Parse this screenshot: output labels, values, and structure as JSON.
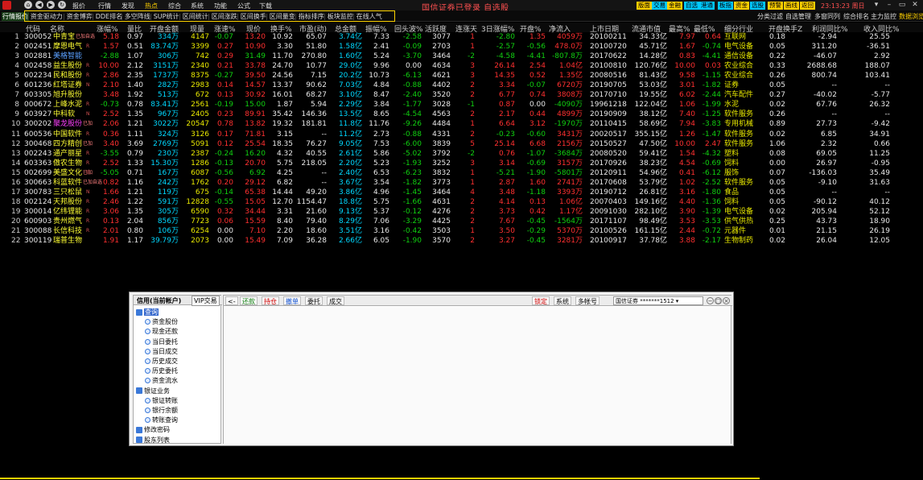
{
  "menubar": {
    "items": [
      "报价",
      "行情",
      "发现",
      "热点",
      "综合",
      "系统",
      "功能",
      "公式",
      "下载"
    ],
    "active_item": "热点",
    "title": "国信证券已登录  自选股",
    "buttons": [
      {
        "label": "版面",
        "color": "#ffd000"
      },
      {
        "label": "交易",
        "color": "#00c8ff"
      },
      {
        "label": "金融",
        "color": "#ffd000"
      },
      {
        "label": "自选",
        "color": "#00c8ff"
      },
      {
        "label": "港通",
        "color": "#00c8ff"
      },
      {
        "label": "板指",
        "color": "#00c8ff"
      },
      {
        "label": "资金",
        "color": "#ffd000"
      },
      {
        "label": "选股",
        "color": "#00c8ff"
      },
      {
        "label": "预警",
        "color": "#ffd000"
      },
      {
        "label": "画线",
        "color": "#ffd000"
      },
      {
        "label": "返回",
        "color": "#ffd000"
      }
    ],
    "time": "23:13:23 周日"
  },
  "toolbar": {
    "first": "行情报价",
    "items": [
      "资金驱动力",
      "资金博弈",
      "DDE排名",
      "多空阵线",
      "SUP统计",
      "区间统计",
      "区间涨跌",
      "区间换手",
      "区间量变",
      "指标排序",
      "板块监控",
      "在线人气"
    ],
    "right_items": [
      "分类过滤",
      "自选管理",
      "多窗同列",
      "综合排名",
      "主力监控",
      "数据浏览"
    ]
  },
  "table": {
    "headers": [
      "代码",
      "名称",
      "涨幅%",
      "量比",
      "开盘金额",
      "现量",
      "涨速%",
      "现价",
      "换手%",
      "市盈(动)",
      "总金额",
      "振幅%",
      "回头波%",
      "活跃度",
      "连涨天",
      "3日涨幅%",
      "开盘%",
      "净流入",
      "上市日期",
      "流通市值",
      "最高%",
      "最低%",
      "细分行业",
      "开盘换手Z",
      "利润同比%",
      "收入同比%"
    ],
    "rows": [
      {
        "i": "1",
        "code": "300052",
        "name": "中青宝",
        "nc": "y",
        "tag": "已加自选",
        "flag": "",
        "chg": "5.18",
        "lb": "0.97",
        "kje": "334万",
        "xl": "4147",
        "zs": "-0.07",
        "xj": "13.20",
        "hs": "10.92",
        "syl": "65.07",
        "zje": "3.74亿",
        "zf": "7.33",
        "htb": "-2.58",
        "hyd": "3077",
        "lzt": "1",
        "r3": "-2.80",
        "kp": "1.35",
        "jlr": "4059万",
        "ssrq": "20100211",
        "ltsz": "34.33亿",
        "zg": "7.97",
        "zd": "0.64",
        "hy": "互联网",
        "kphs": "0.18",
        "lr": "-2.94",
        "sr": "25.55"
      },
      {
        "i": "2",
        "code": "002451",
        "name": "摩恩电气",
        "nc": "y",
        "tag": "",
        "flag": "R",
        "chg": "1.57",
        "lb": "0.51",
        "kje": "83.74万",
        "xl": "3399",
        "zs": "0.27",
        "xj": "10.90",
        "hs": "3.30",
        "syl": "51.80",
        "zje": "1.58亿",
        "zf": "2.41",
        "htb": "-0.09",
        "hyd": "2703",
        "lzt": "1",
        "r3": "-2.57",
        "kp": "-0.56",
        "jlr": "478.0万",
        "ssrq": "20100720",
        "ltsz": "45.71亿",
        "zg": "1.67",
        "zd": "-0.74",
        "hy": "电气设备",
        "kphs": "0.05",
        "lr": "311.20",
        "sr": "-36.51"
      },
      {
        "i": "3",
        "code": "002881",
        "name": "美格智能",
        "nc": "b",
        "tag": "",
        "flag": "",
        "chg": "-2.88",
        "lb": "1.07",
        "kje": "306万",
        "xl": "742",
        "zs": "0.29",
        "xj": "31.49",
        "hs": "11.70",
        "syl": "270.80",
        "zje": "1.60亿",
        "zf": "5.24",
        "htb": "-3.70",
        "hyd": "3464",
        "lzt": "-2",
        "r3": "-4.58",
        "kp": "-4.41",
        "jlr": "-807.8万",
        "ssrq": "20170622",
        "ltsz": "14.28亿",
        "zg": "0.83",
        "zd": "-4.41",
        "hy": "通信设备",
        "kphs": "0.22",
        "lr": "-46.07",
        "sr": "2.92"
      },
      {
        "i": "4",
        "code": "002458",
        "name": "益生股份",
        "nc": "y",
        "tag": "",
        "flag": "R",
        "chg": "10.00",
        "lb": "2.12",
        "kje": "3151万",
        "xl": "2340",
        "zs": "0.21",
        "xj": "33.78",
        "hs": "24.70",
        "syl": "10.77",
        "zje": "29.0亿",
        "zf": "9.96",
        "htb": "0.00",
        "hyd": "4634",
        "lzt": "3",
        "r3": "26.14",
        "kp": "2.54",
        "jlr": "1.04亿",
        "ssrq": "20100810",
        "ltsz": "120.76亿",
        "zg": "10.00",
        "zd": "0.03",
        "hy": "农业综合",
        "kphs": "0.33",
        "lr": "2688.68",
        "sr": "188.07"
      },
      {
        "i": "5",
        "code": "002234",
        "name": "民和股份",
        "nc": "y",
        "tag": "",
        "flag": "R",
        "chg": "2.86",
        "lb": "2.35",
        "kje": "1737万",
        "xl": "8375",
        "zs": "-0.27",
        "xj": "39.50",
        "hs": "24.56",
        "syl": "7.15",
        "zje": "20.2亿",
        "zf": "10.73",
        "htb": "-6.13",
        "hyd": "4621",
        "lzt": "3",
        "r3": "14.35",
        "kp": "0.52",
        "jlr": "1.35亿",
        "ssrq": "20080516",
        "ltsz": "81.43亿",
        "zg": "9.58",
        "zd": "-1.15",
        "hy": "农业综合",
        "kphs": "0.26",
        "lr": "800.74",
        "sr": "103.41"
      },
      {
        "i": "6",
        "code": "601236",
        "name": "红塔证券",
        "nc": "y",
        "tag": "",
        "flag": "N",
        "chg": "2.10",
        "lb": "1.40",
        "kje": "282万",
        "xl": "2983",
        "zs": "0.14",
        "xj": "14.57",
        "hs": "13.37",
        "syl": "90.62",
        "zje": "7.03亿",
        "zf": "4.84",
        "htb": "-0.88",
        "hyd": "4402",
        "lzt": "2",
        "r3": "3.34",
        "kp": "-0.07",
        "jlr": "6720万",
        "ssrq": "20190705",
        "ltsz": "53.03亿",
        "zg": "3.01",
        "zd": "-1.82",
        "hy": "证券",
        "kphs": "0.05",
        "lr": "--",
        "sr": "--"
      },
      {
        "i": "7",
        "code": "603305",
        "name": "旭升股份",
        "nc": "y",
        "tag": "",
        "flag": "",
        "chg": "3.48",
        "lb": "1.92",
        "kje": "513万",
        "xl": "672",
        "zs": "0.13",
        "xj": "30.92",
        "hs": "16.01",
        "syl": "68.27",
        "zje": "3.10亿",
        "zf": "8.47",
        "htb": "-2.40",
        "hyd": "3520",
        "lzt": "2",
        "r3": "6.77",
        "kp": "0.74",
        "jlr": "3808万",
        "ssrq": "20170710",
        "ltsz": "19.55亿",
        "zg": "6.02",
        "zd": "-2.44",
        "hy": "汽车配件",
        "kphs": "0.27",
        "lr": "-40.02",
        "sr": "-5.77"
      },
      {
        "i": "8",
        "code": "000672",
        "name": "上峰水泥",
        "nc": "y",
        "tag": "",
        "flag": "R",
        "chg": "-0.73",
        "lb": "0.78",
        "kje": "83.41万",
        "xl": "2561",
        "zs": "-0.19",
        "xj": "15.00",
        "hs": "1.87",
        "syl": "5.94",
        "zje": "2.29亿",
        "zf": "3.84",
        "htb": "-1.77",
        "hyd": "3028",
        "lzt": "-1",
        "r3": "0.87",
        "kp": "0.00",
        "jlr": "-4090万",
        "ssrq": "19961218",
        "ltsz": "122.04亿",
        "zg": "1.06",
        "zd": "-1.99",
        "hy": "水泥",
        "kphs": "0.02",
        "lr": "67.76",
        "sr": "26.32"
      },
      {
        "i": "9",
        "code": "603927",
        "name": "中科软",
        "nc": "y",
        "tag": "",
        "flag": "N",
        "chg": "2.52",
        "lb": "1.35",
        "kje": "967万",
        "xl": "2405",
        "zs": "0.23",
        "xj": "89.91",
        "hs": "35.42",
        "syl": "146.36",
        "zje": "13.5亿",
        "zf": "8.65",
        "htb": "-4.54",
        "hyd": "4563",
        "lzt": "2",
        "r3": "2.17",
        "kp": "0.44",
        "jlr": "4899万",
        "ssrq": "20190909",
        "ltsz": "38.12亿",
        "zg": "7.40",
        "zd": "-1.25",
        "hy": "软件服务",
        "kphs": "0.26",
        "lr": "--",
        "sr": "--"
      },
      {
        "i": "10",
        "code": "300202",
        "name": "聚龙股份",
        "nc": "m",
        "tag": "已加",
        "flag": "",
        "chg": "2.06",
        "lb": "1.21",
        "kje": "3022万",
        "xl": "20547",
        "zs": "0.78",
        "xj": "13.82",
        "hs": "19.32",
        "syl": "181.81",
        "zje": "11.8亿",
        "zf": "11.76",
        "htb": "-9.26",
        "hyd": "4484",
        "lzt": "1",
        "r3": "6.64",
        "kp": "3.12",
        "jlr": "-1970万",
        "ssrq": "20110415",
        "ltsz": "58.69亿",
        "zg": "7.94",
        "zd": "-3.83",
        "hy": "专用机械",
        "kphs": "0.89",
        "lr": "27.73",
        "sr": "-9.42"
      },
      {
        "i": "11",
        "code": "600536",
        "name": "中国软件",
        "nc": "y",
        "tag": "",
        "flag": "R",
        "chg": "0.36",
        "lb": "1.11",
        "kje": "324万",
        "xl": "3126",
        "zs": "0.17",
        "xj": "71.81",
        "hs": "3.15",
        "syl": "--",
        "zje": "11.2亿",
        "zf": "2.73",
        "htb": "-0.88",
        "hyd": "4331",
        "lzt": "2",
        "r3": "-0.23",
        "kp": "-0.60",
        "jlr": "3431万",
        "ssrq": "20020517",
        "ltsz": "355.15亿",
        "zg": "1.26",
        "zd": "-1.47",
        "hy": "软件服务",
        "kphs": "0.02",
        "lr": "6.85",
        "sr": "34.91"
      },
      {
        "i": "12",
        "code": "300468",
        "name": "四方精创",
        "nc": "y",
        "tag": "已加",
        "flag": "",
        "chg": "3.40",
        "lb": "3.69",
        "kje": "2769万",
        "xl": "5091",
        "zs": "0.12",
        "xj": "25.54",
        "hs": "18.35",
        "syl": "76.27",
        "zje": "9.05亿",
        "zf": "7.53",
        "htb": "-6.00",
        "hyd": "3839",
        "lzt": "5",
        "r3": "25.14",
        "kp": "6.68",
        "jlr": "2156万",
        "ssrq": "20150527",
        "ltsz": "47.50亿",
        "zg": "10.00",
        "zd": "2.47",
        "hy": "软件服务",
        "kphs": "1.06",
        "lr": "2.32",
        "sr": "0.66"
      },
      {
        "i": "13",
        "code": "002243",
        "name": "通产丽星",
        "nc": "y",
        "tag": "",
        "flag": "R",
        "chg": "-3.55",
        "lb": "0.79",
        "kje": "230万",
        "xl": "2387",
        "zs": "-0.24",
        "xj": "16.20",
        "hs": "4.32",
        "syl": "40.55",
        "zje": "2.61亿",
        "zf": "5.86",
        "htb": "-5.02",
        "hyd": "3792",
        "lzt": "-2",
        "r3": "0.76",
        "kp": "-1.07",
        "jlr": "-3684万",
        "ssrq": "20080520",
        "ltsz": "59.41亿",
        "zg": "1.54",
        "zd": "-4.32",
        "hy": "塑料",
        "kphs": "0.08",
        "lr": "69.05",
        "sr": "11.25"
      },
      {
        "i": "14",
        "code": "603363",
        "name": "傲农生物",
        "nc": "y",
        "tag": "",
        "flag": "R",
        "chg": "2.52",
        "lb": "1.33",
        "kje": "15.30万",
        "xl": "1286",
        "zs": "-0.13",
        "xj": "20.70",
        "hs": "5.75",
        "syl": "218.05",
        "zje": "2.20亿",
        "zf": "5.23",
        "htb": "-1.93",
        "hyd": "3252",
        "lzt": "3",
        "r3": "3.14",
        "kp": "-0.69",
        "jlr": "3157万",
        "ssrq": "20170926",
        "ltsz": "38.23亿",
        "zg": "4.54",
        "zd": "-0.69",
        "hy": "饲料",
        "kphs": "0.00",
        "lr": "26.97",
        "sr": "-0.95"
      },
      {
        "i": "15",
        "code": "002699",
        "name": "美盛文化",
        "nc": "y",
        "tag": "已加",
        "flag": "R",
        "chg": "-5.05",
        "lb": "0.71",
        "kje": "167万",
        "xl": "6087",
        "zs": "-0.56",
        "xj": "6.92",
        "hs": "4.25",
        "syl": "--",
        "zje": "2.40亿",
        "zf": "6.53",
        "htb": "-6.23",
        "hyd": "3832",
        "lzt": "1",
        "r3": "-5.21",
        "kp": "-1.90",
        "jlr": "-5801万",
        "ssrq": "20120911",
        "ltsz": "54.96亿",
        "zg": "0.41",
        "zd": "-6.12",
        "hy": "服饰",
        "kphs": "0.07",
        "lr": "-136.03",
        "sr": "35.49"
      },
      {
        "i": "16",
        "code": "300663",
        "name": "科蓝软件",
        "nc": "y",
        "tag": "已加自选",
        "flag": "",
        "chg": "0.82",
        "lb": "1.16",
        "kje": "242万",
        "xl": "1762",
        "zs": "0.20",
        "xj": "29.12",
        "hs": "6.82",
        "syl": "--",
        "zje": "3.67亿",
        "zf": "3.54",
        "htb": "-1.82",
        "hyd": "3773",
        "lzt": "1",
        "r3": "2.87",
        "kp": "1.60",
        "jlr": "2741万",
        "ssrq": "20170608",
        "ltsz": "53.79亿",
        "zg": "1.02",
        "zd": "-2.52",
        "hy": "软件服务",
        "kphs": "0.05",
        "lr": "-9.10",
        "sr": "31.63"
      },
      {
        "i": "17",
        "code": "300783",
        "name": "三只松鼠",
        "nc": "y",
        "tag": "",
        "flag": "N",
        "chg": "1.66",
        "lb": "1.21",
        "kje": "119万",
        "xl": "675",
        "zs": "-0.14",
        "xj": "65.38",
        "hs": "14.44",
        "syl": "49.20",
        "zje": "3.86亿",
        "zf": "4.96",
        "htb": "-1.45",
        "hyd": "3464",
        "lzt": "4",
        "r3": "3.48",
        "kp": "-1.18",
        "jlr": "3393万",
        "ssrq": "20190712",
        "ltsz": "26.81亿",
        "zg": "3.16",
        "zd": "-1.80",
        "hy": "食品",
        "kphs": "0.05",
        "lr": "--",
        "sr": "--"
      },
      {
        "i": "18",
        "code": "002124",
        "name": "天邦股份",
        "nc": "y",
        "tag": "",
        "flag": "R",
        "chg": "2.46",
        "lb": "1.22",
        "kje": "591万",
        "xl": "12828",
        "zs": "-0.55",
        "xj": "15.05",
        "hs": "12.70",
        "syl": "1154.47",
        "zje": "18.8亿",
        "zf": "5.75",
        "htb": "-1.66",
        "hyd": "4631",
        "lzt": "2",
        "r3": "4.14",
        "kp": "0.13",
        "jlr": "1.06亿",
        "ssrq": "20070403",
        "ltsz": "149.16亿",
        "zg": "4.40",
        "zd": "-1.36",
        "hy": "饲料",
        "kphs": "0.05",
        "lr": "-90.12",
        "sr": "40.12"
      },
      {
        "i": "19",
        "code": "300014",
        "name": "亿纬锂能",
        "nc": "y",
        "tag": "",
        "flag": "R",
        "chg": "3.06",
        "lb": "1.35",
        "kje": "305万",
        "xl": "6590",
        "zs": "0.32",
        "xj": "34.44",
        "hs": "3.31",
        "syl": "21.60",
        "zje": "9.13亿",
        "zf": "5.37",
        "htb": "-0.12",
        "hyd": "4276",
        "lzt": "2",
        "r3": "3.73",
        "kp": "0.42",
        "jlr": "1.17亿",
        "ssrq": "20091030",
        "ltsz": "282.10亿",
        "zg": "3.90",
        "zd": "-1.39",
        "hy": "电气设备",
        "kphs": "0.02",
        "lr": "205.94",
        "sr": "52.12"
      },
      {
        "i": "20",
        "code": "600903",
        "name": "贵州燃气",
        "nc": "y",
        "tag": "",
        "flag": "R",
        "chg": "0.13",
        "lb": "2.04",
        "kje": "856万",
        "xl": "7723",
        "zs": "0.06",
        "xj": "15.59",
        "hs": "8.40",
        "syl": "79.40",
        "zje": "8.29亿",
        "zf": "7.06",
        "htb": "-3.29",
        "hyd": "4425",
        "lzt": "2",
        "r3": "7.67",
        "kp": "-0.45",
        "jlr": "-1564万",
        "ssrq": "20171107",
        "ltsz": "98.49亿",
        "zg": "3.53",
        "zd": "-3.53",
        "hy": "供气供热",
        "kphs": "0.25",
        "lr": "43.73",
        "sr": "18.90"
      },
      {
        "i": "21",
        "code": "300088",
        "name": "长信科技",
        "nc": "y",
        "tag": "",
        "flag": "R",
        "chg": "2.01",
        "lb": "0.80",
        "kje": "106万",
        "xl": "6254",
        "zs": "0.00",
        "xj": "7.10",
        "hs": "2.20",
        "syl": "18.60",
        "zje": "3.51亿",
        "zf": "3.16",
        "htb": "-0.42",
        "hyd": "3503",
        "lzt": "1",
        "r3": "3.50",
        "kp": "-0.29",
        "jlr": "5370万",
        "ssrq": "20100526",
        "ltsz": "161.15亿",
        "zg": "2.44",
        "zd": "-0.72",
        "hy": "元器件",
        "kphs": "0.01",
        "lr": "21.15",
        "sr": "26.19"
      },
      {
        "i": "22",
        "code": "300119",
        "name": "瑞普生物",
        "nc": "y",
        "tag": "",
        "flag": "",
        "chg": "1.91",
        "lb": "1.17",
        "kje": "39.79万",
        "xl": "2073",
        "zs": "0.00",
        "xj": "15.49",
        "hs": "7.09",
        "syl": "36.28",
        "zje": "2.66亿",
        "zf": "6.05",
        "htb": "-1.90",
        "hyd": "3570",
        "lzt": "2",
        "r3": "3.27",
        "kp": "-0.45",
        "jlr": "3281万",
        "ssrq": "20100917",
        "ltsz": "37.78亿",
        "zg": "3.88",
        "zd": "-2.17",
        "hy": "生物制药",
        "kphs": "0.02",
        "lr": "26.04",
        "sr": "12.05"
      }
    ]
  },
  "trade": {
    "tab_active": "信用(当前帐户)",
    "tab_vip": "VIP交易",
    "tree": [
      {
        "label": "查询",
        "level": 0,
        "sel": true
      },
      {
        "label": "资金股份",
        "level": 1
      },
      {
        "label": "现金还款",
        "level": 1
      },
      {
        "label": "当日委托",
        "level": 1
      },
      {
        "label": "当日成交",
        "level": 1
      },
      {
        "label": "历史成交",
        "level": 1
      },
      {
        "label": "历史委托",
        "level": 1
      },
      {
        "label": "资金流水",
        "level": 1
      },
      {
        "label": "银证业务",
        "level": 0
      },
      {
        "label": "银证转账",
        "level": 1
      },
      {
        "label": "银行余额",
        "level": 1
      },
      {
        "label": "转账查询",
        "level": 1
      },
      {
        "label": "修改密码",
        "level": 0
      },
      {
        "label": "股东列表",
        "level": 0
      }
    ],
    "toolbar": [
      "<-",
      "还款",
      "持仓",
      "撤单",
      "委托",
      "成交"
    ],
    "right_buttons": [
      "锁定",
      "系统",
      "多帐号"
    ],
    "broker": "国信证券",
    "account": "*******1512"
  }
}
